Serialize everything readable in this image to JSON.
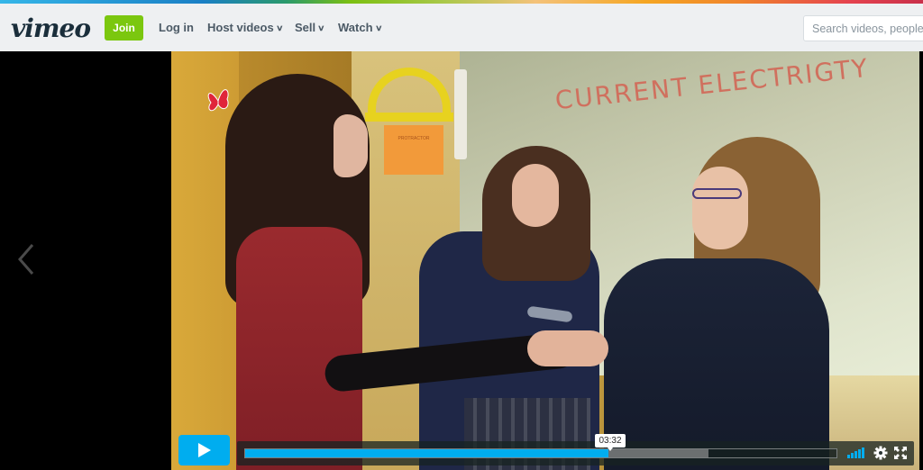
{
  "header": {
    "logo": "vimeo",
    "join_label": "Join",
    "nav": [
      {
        "label": "Log in",
        "has_dropdown": false
      },
      {
        "label": "Host videos",
        "has_dropdown": true
      },
      {
        "label": "Sell",
        "has_dropdown": true
      },
      {
        "label": "Watch",
        "has_dropdown": true
      }
    ],
    "search_placeholder": "Search videos, people, and more",
    "search_visible_text": "Search videos, people,"
  },
  "colors": {
    "brand_green": "#7bc70f",
    "player_accent": "#00adef",
    "header_bg": "#eef0f2"
  },
  "stage": {
    "prev_icon": "chevron-left-icon"
  },
  "video": {
    "whiteboard_text": "CURRENT ELECTRIGTY",
    "protractor_sign_text": "PROTRACTOR"
  },
  "player": {
    "state": "paused",
    "play_icon": "play-icon",
    "current_time_tooltip": "03:32",
    "played_fraction": 0.615,
    "buffered_fraction": 0.784,
    "volume_level_bars": 5,
    "settings_icon": "gear-icon",
    "fullscreen_icon": "fullscreen-icon"
  }
}
